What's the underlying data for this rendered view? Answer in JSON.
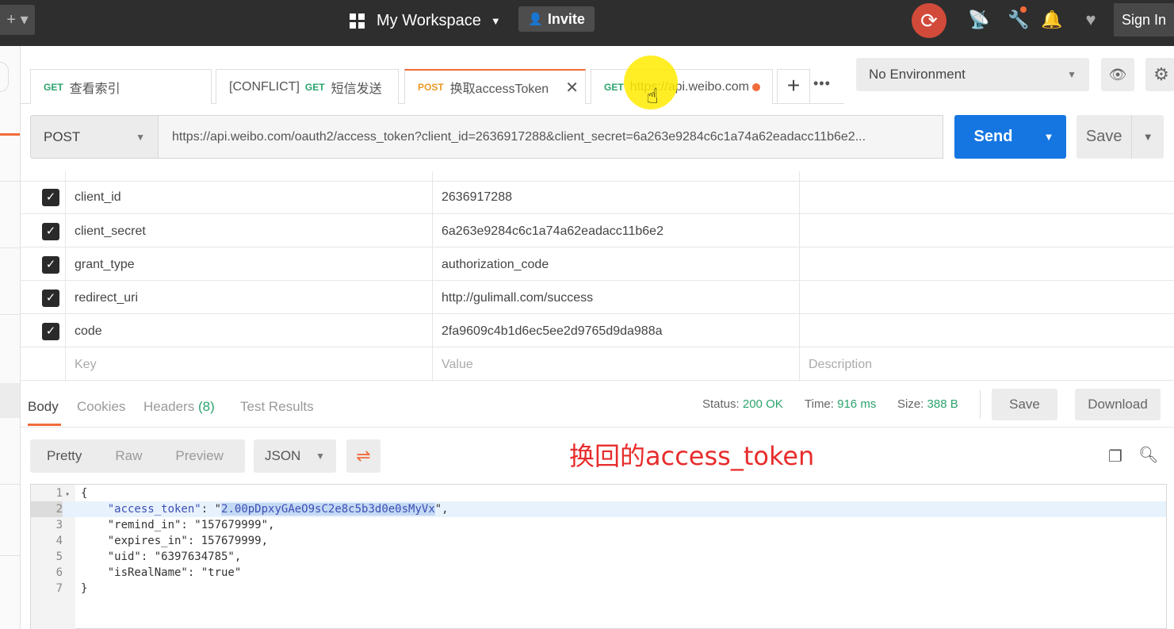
{
  "topbar": {
    "left_button": "+ ▾",
    "workspace": "My Workspace",
    "invite": "Invite",
    "sign_in": "Sign In"
  },
  "tabs": [
    {
      "method": "GET",
      "label": "查看索引"
    },
    {
      "prefix": "[CONFLICT]",
      "method": "GET",
      "label": "短信发送"
    },
    {
      "method": "POST",
      "label": "换取accessToken"
    },
    {
      "method": "GET",
      "label": "https://api.weibo.com"
    }
  ],
  "environment": "No Environment",
  "request": {
    "method": "POST",
    "url": "https://api.weibo.com/oauth2/access_token?client_id=2636917288&client_secret=6a263e9284c6c1a74a62eadacc11b6e2...",
    "send": "Send",
    "save": "Save"
  },
  "params": [
    {
      "key": "client_id",
      "value": "2636917288"
    },
    {
      "key": "client_secret",
      "value": "6a263e9284c6c1a74a62eadacc11b6e2"
    },
    {
      "key": "grant_type",
      "value": "authorization_code"
    },
    {
      "key": "redirect_uri",
      "value": "http://gulimall.com/success"
    },
    {
      "key": "code",
      "value": "2fa9609c4b1d6ec5ee2d9765d9da988a"
    }
  ],
  "params_placeholder": {
    "key": "Key",
    "value": "Value",
    "description": "Description"
  },
  "response": {
    "tabs": {
      "body": "Body",
      "cookies": "Cookies",
      "headers": "Headers",
      "headers_count": "(8)",
      "tests": "Test Results"
    },
    "status_label": "Status:",
    "status": "200 OK",
    "time_label": "Time:",
    "time": "916 ms",
    "size_label": "Size:",
    "size": "388 B",
    "save": "Save",
    "download": "Download",
    "views": {
      "pretty": "Pretty",
      "raw": "Raw",
      "preview": "Preview"
    },
    "format": "JSON"
  },
  "annotation": "换回的access_token",
  "code_lines": [
    {
      "n": "1",
      "fold": "▾",
      "text": "{"
    },
    {
      "n": "2",
      "key": "\"access_token\"",
      "sep": ": \"",
      "selected": "2.00pDpxyGAeO9sC2e8c5b3d0e0sMyVx",
      "tail": "\","
    },
    {
      "n": "3",
      "text": "    \"remind_in\": \"157679999\","
    },
    {
      "n": "4",
      "text": "    \"expires_in\": 157679999,"
    },
    {
      "n": "5",
      "text": "    \"uid\": \"6397634785\","
    },
    {
      "n": "6",
      "text": "    \"isRealName\": \"true\""
    },
    {
      "n": "7",
      "text": "}"
    }
  ],
  "colors": {
    "accent": "#f26b3a",
    "send": "#1576e2",
    "status_ok": "#2ca36c",
    "annotation": "#e82c2c"
  }
}
